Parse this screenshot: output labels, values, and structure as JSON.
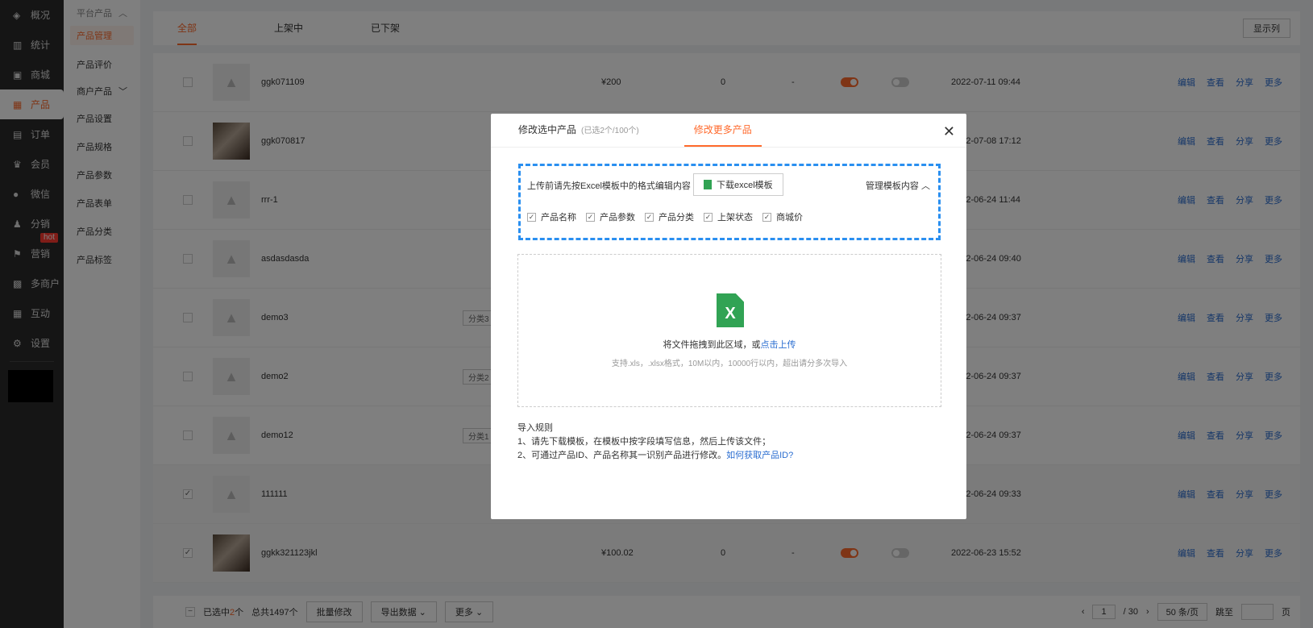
{
  "leftnav": {
    "items": [
      {
        "label": "概况",
        "icon": "layers-icon"
      },
      {
        "label": "统计",
        "icon": "chart-icon"
      },
      {
        "label": "商城",
        "icon": "store-icon"
      },
      {
        "label": "产品",
        "icon": "grid-icon"
      },
      {
        "label": "订单",
        "icon": "clipboard-icon"
      },
      {
        "label": "会员",
        "icon": "crown-icon"
      },
      {
        "label": "微信",
        "icon": "wechat-icon"
      },
      {
        "label": "分销",
        "icon": "user-share-icon"
      },
      {
        "label": "营销",
        "icon": "flag-icon"
      },
      {
        "label": "多商户",
        "icon": "multi-store-icon"
      },
      {
        "label": "互动",
        "icon": "interact-icon"
      },
      {
        "label": "设置",
        "icon": "gear-icon"
      }
    ],
    "hot_badge": "hot"
  },
  "subnav": {
    "group1": "平台产品",
    "items1": [
      "产品管理",
      "产品评价"
    ],
    "group2": "商户产品",
    "items2": [
      "产品设置",
      "产品规格",
      "产品参数",
      "产品表单",
      "产品分类",
      "产品标签"
    ]
  },
  "tabs": [
    "全部",
    "上架中",
    "已下架"
  ],
  "columns_button": "显示列",
  "rows": [
    {
      "name": "ggk071109",
      "category": "",
      "price": "¥200",
      "stock": "0",
      "dash": "-",
      "date": "2022-07-11 09:44",
      "checked": false,
      "photo": false
    },
    {
      "name": "ggk070817",
      "category": "",
      "price": "",
      "stock": "",
      "dash": "",
      "date": "2022-07-08 17:12",
      "checked": false,
      "photo": true
    },
    {
      "name": "rrr-1",
      "category": "",
      "price": "",
      "stock": "",
      "dash": "",
      "date": "2022-06-24 11:44",
      "checked": false,
      "photo": false
    },
    {
      "name": "asdasdasda",
      "category": "",
      "price": "",
      "stock": "",
      "dash": "",
      "date": "2022-06-24 09:40",
      "checked": false,
      "photo": false
    },
    {
      "name": "demo3",
      "category": "分类3",
      "price": "",
      "stock": "",
      "dash": "",
      "date": "2022-06-24 09:37",
      "checked": false,
      "photo": false
    },
    {
      "name": "demo2",
      "category": "分类2",
      "price": "",
      "stock": "",
      "dash": "",
      "date": "2022-06-24 09:37",
      "checked": false,
      "photo": false
    },
    {
      "name": "demo12",
      "category": "分类1",
      "price": "",
      "stock": "",
      "dash": "",
      "date": "2022-06-24 09:37",
      "checked": false,
      "photo": false
    },
    {
      "name": "111111",
      "category": "",
      "price": "",
      "stock": "",
      "dash": "",
      "date": "2022-06-24 09:33",
      "checked": true,
      "photo": false
    },
    {
      "name": "ggkk321123jkl",
      "category": "",
      "price": "¥100.02",
      "stock": "0",
      "dash": "-",
      "date": "2022-06-23 15:52",
      "checked": true,
      "photo": true
    }
  ],
  "row_ops": [
    "编辑",
    "查看",
    "分享",
    "更多"
  ],
  "bottom": {
    "selected_prefix": "已选中",
    "selected_count": "2",
    "selected_suffix": "个",
    "total": "总共1497个",
    "batch_edit": "批量修改",
    "export": "导出数据",
    "more": "更多",
    "page": "1",
    "page_total": "/ 30",
    "per_page": "50 条/页",
    "jump_label": "跳至",
    "page_word": "页"
  },
  "modal": {
    "tab1": "修改选中产品",
    "tab1_meta": "(已选2个/100个)",
    "tab2": "修改更多产品",
    "hint": "上传前请先按Excel模板中的格式编辑内容",
    "download": "下载excel模板",
    "manage": "管理模板内容",
    "checks": [
      "产品名称",
      "产品参数",
      "产品分类",
      "上架状态",
      "商城价"
    ],
    "drop_text": "将文件拖拽到此区域，或",
    "drop_link": "点击上传",
    "drop_sub": "支持.xls，.xlsx格式，10M以内，10000行以内，超出请分多次导入",
    "rules_title": "导入规则",
    "rule1": "1、请先下载模板，在模板中按字段填写信息，然后上传该文件；",
    "rule2": "2、可通过产品ID、产品名称其一识别产品进行修改。",
    "rule2_link": "如何获取产品ID?"
  },
  "colors": {
    "accent": "#ff6a2c",
    "link": "#2a6dd0",
    "dashed_border": "#2a8ff0",
    "excel": "#31a354"
  }
}
